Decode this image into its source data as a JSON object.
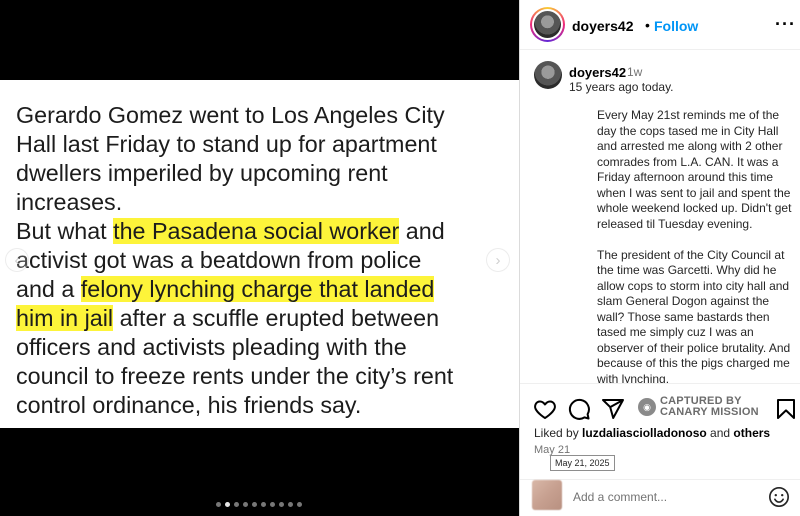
{
  "slide": {
    "lines": [
      [
        {
          "t": "Gerardo Gomez went to Los Angeles City",
          "h": false
        }
      ],
      [
        {
          "t": "Hall last Friday to stand up for apartment",
          "h": false
        }
      ],
      [
        {
          "t": "dwellers imperiled by upcoming rent",
          "h": false
        }
      ],
      [
        {
          "t": "increases.",
          "h": false
        }
      ],
      [
        {
          "t": "But what ",
          "h": false
        },
        {
          "t": "the Pasadena social worker",
          "h": true
        },
        {
          "t": " and",
          "h": false
        }
      ],
      [
        {
          "t": "activist got was a beatdown from police",
          "h": false
        }
      ],
      [
        {
          "t": "and a ",
          "h": false
        },
        {
          "t": "felony lynching charge that landed",
          "h": true
        }
      ],
      [
        {
          "t": "him in jail",
          "h": true
        },
        {
          "t": " after a scuffle erupted between",
          "h": false
        }
      ],
      [
        {
          "t": "officers and activists pleading with the",
          "h": false
        }
      ],
      [
        {
          "t": "council to freeze rents under the city’s rent",
          "h": false
        }
      ],
      [
        {
          "t": "control ordinance, his friends say.",
          "h": false
        }
      ]
    ],
    "prev_icon": "‹",
    "next_icon": "›",
    "dots_total": 10,
    "dots_active": 1
  },
  "header": {
    "username": "doyers42",
    "dot": "•",
    "follow_label": "Follow",
    "more_icon": "···"
  },
  "caption": {
    "username": "doyers42",
    "time": "1w",
    "line1": "15 years ago today.",
    "paragraphs": [
      "Every May 21st reminds me of the day the cops tased me in City Hall and arrested me along with 2 other comrades from L.A. CAN. It was a Friday afternoon around this time when I was sent to jail and spent the whole weekend locked up. Didn't get released til Tuesday evening.",
      "The president of the City Council at the time was Garcetti. Why did he allow cops to storm into city hall and slam General Dogon against the wall? Those same bastards then tased me simply cuz I was an observer of their police brutality. And because of this the pigs charged me with lynching."
    ]
  },
  "actions": {
    "watermark_line1": "CAPTURED BY",
    "watermark_line2": "CANARY MISSION",
    "likes_prefix": "Liked by ",
    "likes_user": "luzdaliasciolladonoso",
    "likes_mid": " and ",
    "likes_others": "others",
    "date": "May 21",
    "tooltip": "May 21, 2025",
    "comment_placeholder": "Add a comment..."
  }
}
